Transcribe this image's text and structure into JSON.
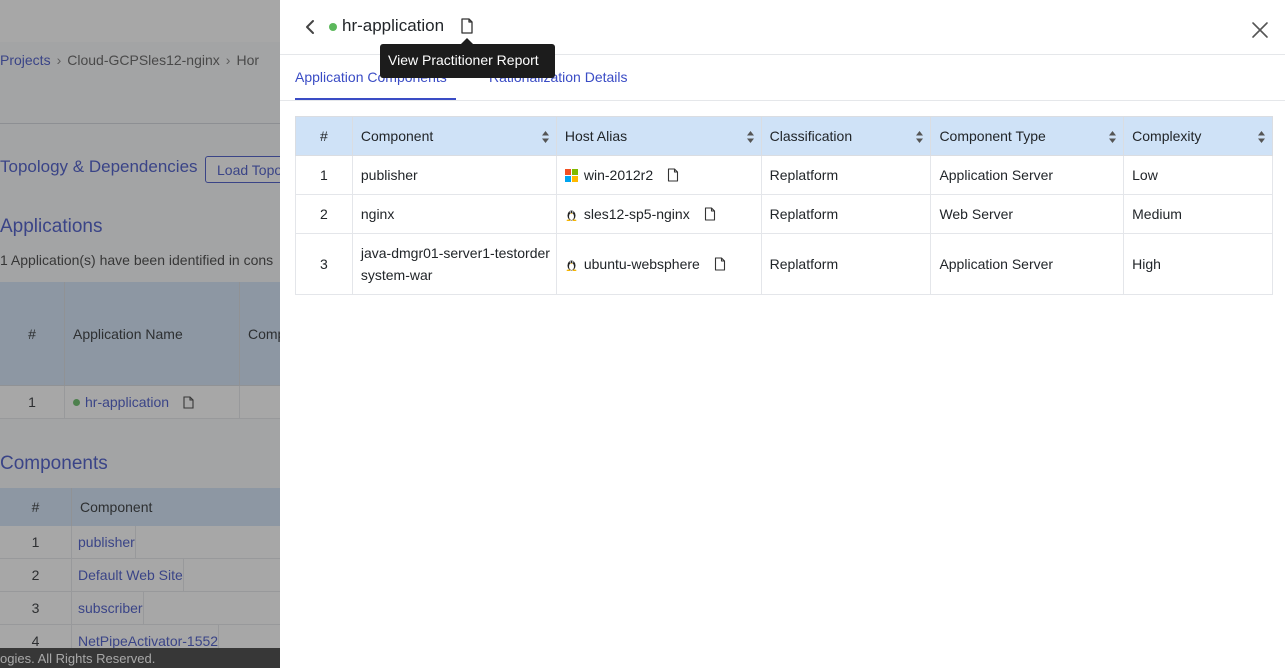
{
  "background": {
    "breadcrumb": [
      "Projects",
      "Cloud-GCPSles12-nginx",
      "Hor"
    ],
    "topology_title": "Topology & Dependencies",
    "load_button": "Load Topo",
    "applications_title": "Applications",
    "applications_desc": "1 Application(s) have been identified in cons",
    "apps_table": {
      "headers": [
        "#",
        "Application Name",
        "Comp"
      ],
      "row": {
        "num": "1",
        "name": "hr-application"
      }
    },
    "components_title": "Components",
    "comp_table": {
      "headers": [
        "#",
        "Component"
      ],
      "rows": [
        {
          "num": "1",
          "name": "publisher"
        },
        {
          "num": "2",
          "name": "Default Web Site"
        },
        {
          "num": "3",
          "name": "subscriber"
        },
        {
          "num": "4",
          "name": "NetPipeActivator-1552"
        }
      ]
    },
    "footer": "ogies. All Rights Reserved."
  },
  "panel": {
    "title": "hr-application",
    "status_color": "#5cb85c",
    "tooltip": "View Practitioner Report",
    "tabs": {
      "active": "Application Components",
      "inactive": "Rationalization Details"
    },
    "table": {
      "headers": {
        "num": "#",
        "component": "Component",
        "host_alias": "Host Alias",
        "classification": "Classification",
        "component_type": "Component Type",
        "complexity": "Complexity"
      },
      "rows": [
        {
          "num": "1",
          "component": "publisher",
          "host": "win-2012r2",
          "os_icon": "windows-icon",
          "classification": "Replatform",
          "type": "Application Server",
          "complexity": "Low"
        },
        {
          "num": "2",
          "component": "nginx",
          "host": "sles12-sp5-nginx",
          "os_icon": "linux-icon",
          "classification": "Replatform",
          "type": "Web Server",
          "complexity": "Medium"
        },
        {
          "num": "3",
          "component": "java-dmgr01-server1-testordersystem-war",
          "host": "ubuntu-websphere",
          "os_icon": "linux-icon",
          "classification": "Replatform",
          "type": "Application Server",
          "complexity": "High"
        }
      ]
    }
  }
}
